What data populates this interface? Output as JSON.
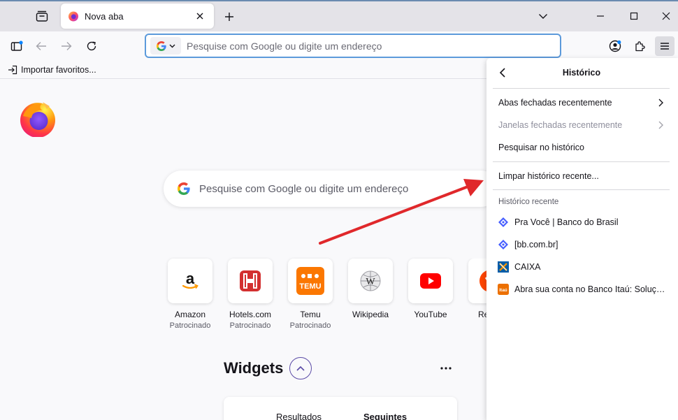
{
  "tab": {
    "title": "Nova aba"
  },
  "urlbar": {
    "placeholder": "Pesquise com Google ou digite um endereço"
  },
  "bookmarks": {
    "import_label": "Importar favoritos..."
  },
  "newtab": {
    "search_placeholder": "Pesquise com Google ou digite um endereço",
    "tiles": [
      {
        "label": "Amazon",
        "sublabel": "Patrocinado"
      },
      {
        "label": "Hotels.com",
        "sublabel": "Patrocinado"
      },
      {
        "label": "Temu",
        "sublabel": "Patrocinado"
      },
      {
        "label": "Wikipedia",
        "sublabel": ""
      },
      {
        "label": "YouTube",
        "sublabel": ""
      },
      {
        "label": "Re",
        "sublabel": ""
      }
    ],
    "widgets": {
      "title": "Widgets",
      "tabs": [
        "Resultados",
        "Seguintes"
      ]
    }
  },
  "history_panel": {
    "title": "Histórico",
    "items": {
      "closed_tabs": "Abas fechadas recentemente",
      "closed_windows": "Janelas fechadas recentemente",
      "search_history": "Pesquisar no histórico",
      "clear_recent": "Limpar histórico recente..."
    },
    "recent_section": "Histórico recente",
    "recent": [
      {
        "label": "Pra Você | Banco do Brasil",
        "icon": "banco-do-brasil-icon"
      },
      {
        "label": "[bb.com.br]",
        "icon": "banco-do-brasil-icon"
      },
      {
        "label": "CAIXA",
        "icon": "caixa-icon"
      },
      {
        "label": "Abra sua conta no Banco Itaú: Soluções para você",
        "icon": "itau-icon"
      }
    ]
  },
  "colors": {
    "accent": "#5c9adb",
    "annotation_arrow": "#e0282b",
    "bb_yellow": "#f7e21a",
    "itau_orange": "#ec7000"
  }
}
